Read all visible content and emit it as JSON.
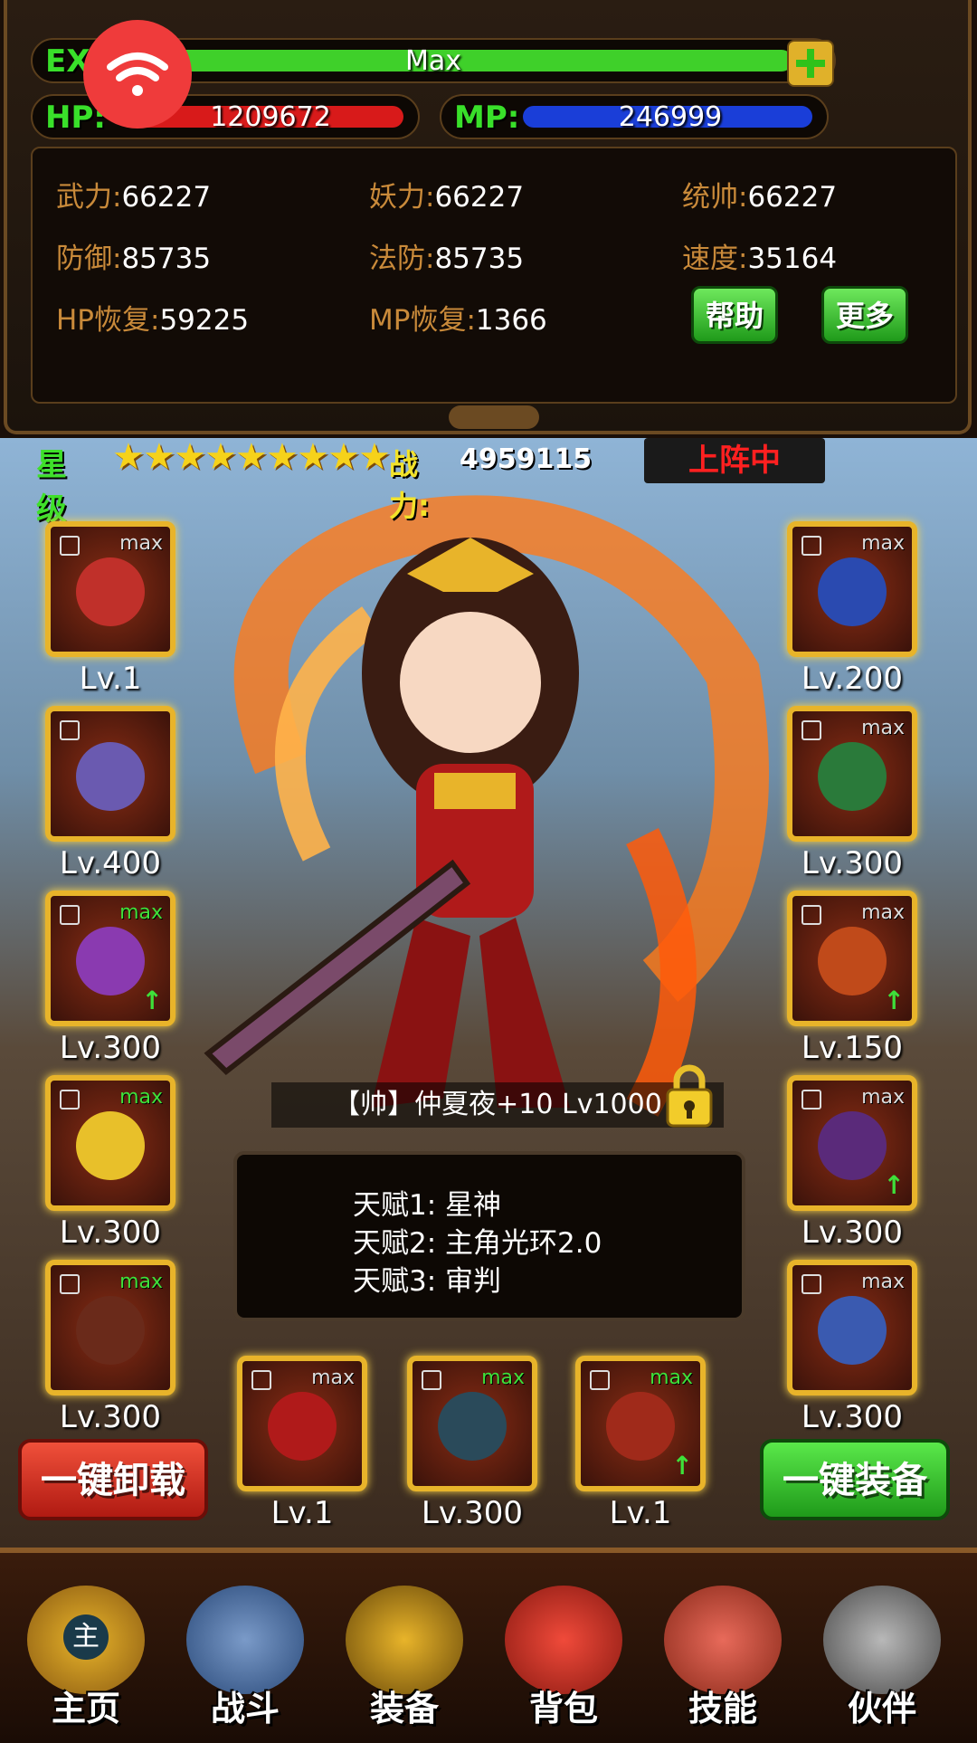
{
  "stats": {
    "exp_label": "EXP",
    "exp_value": "Max",
    "hp_label": "HP:",
    "hp_value": "1209672",
    "mp_label": "MP:",
    "mp_value": "246999",
    "attributes": [
      {
        "key": "武力:",
        "value": "66227"
      },
      {
        "key": "妖力:",
        "value": "66227"
      },
      {
        "key": "统帅:",
        "value": "66227"
      },
      {
        "key": "防御:",
        "value": "85735"
      },
      {
        "key": "法防:",
        "value": "85735"
      },
      {
        "key": "速度:",
        "value": "35164"
      },
      {
        "key": "HP恢复:",
        "value": "59225"
      },
      {
        "key": "MP恢复:",
        "value": "1366"
      }
    ],
    "help_button": "帮助",
    "more_button": "更多"
  },
  "hero": {
    "star_label": "星级",
    "star_count": 9,
    "power_label": "战力:",
    "power_value": "4959115",
    "status": "上阵中",
    "name": "【帅】仲夏夜+10 Lv1000",
    "talents": [
      "天赋1:  星神",
      "天赋2:  主角光环2.0",
      "天赋3:  审判"
    ]
  },
  "equipment": {
    "left": [
      {
        "level": "Lv.1",
        "max": "max",
        "upgrade": false
      },
      {
        "level": "Lv.400",
        "max": "",
        "upgrade": false
      },
      {
        "level": "Lv.300",
        "max": "max",
        "upgrade": true
      },
      {
        "level": "Lv.300",
        "max": "max",
        "upgrade": false
      },
      {
        "level": "Lv.300",
        "max": "max",
        "upgrade": false
      }
    ],
    "right": [
      {
        "level": "Lv.200",
        "max": "max",
        "upgrade": false
      },
      {
        "level": "Lv.300",
        "max": "max",
        "upgrade": false
      },
      {
        "level": "Lv.150",
        "max": "max",
        "upgrade": true
      },
      {
        "level": "Lv.300",
        "max": "max",
        "upgrade": true
      },
      {
        "level": "Lv.300",
        "max": "max",
        "upgrade": false
      }
    ],
    "bottom": [
      {
        "level": "Lv.1",
        "max": "max",
        "upgrade": false
      },
      {
        "level": "Lv.300",
        "max": "max",
        "upgrade": false
      },
      {
        "level": "Lv.1",
        "max": "max",
        "upgrade": true
      }
    ],
    "unequip_all": "一键卸载",
    "equip_all": "一键装备"
  },
  "nav": {
    "home_badge": "主",
    "items": [
      "主页",
      "战斗",
      "装备",
      "背包",
      "技能",
      "伙伴"
    ]
  },
  "colors": {
    "exp_fill": "#3fd02a",
    "hp_fill": "#d81a1a",
    "mp_fill": "#1a3ed8",
    "gold_frame": "#e8b42a",
    "green_button": "#1f9a1a",
    "red_button": "#c4201a"
  }
}
